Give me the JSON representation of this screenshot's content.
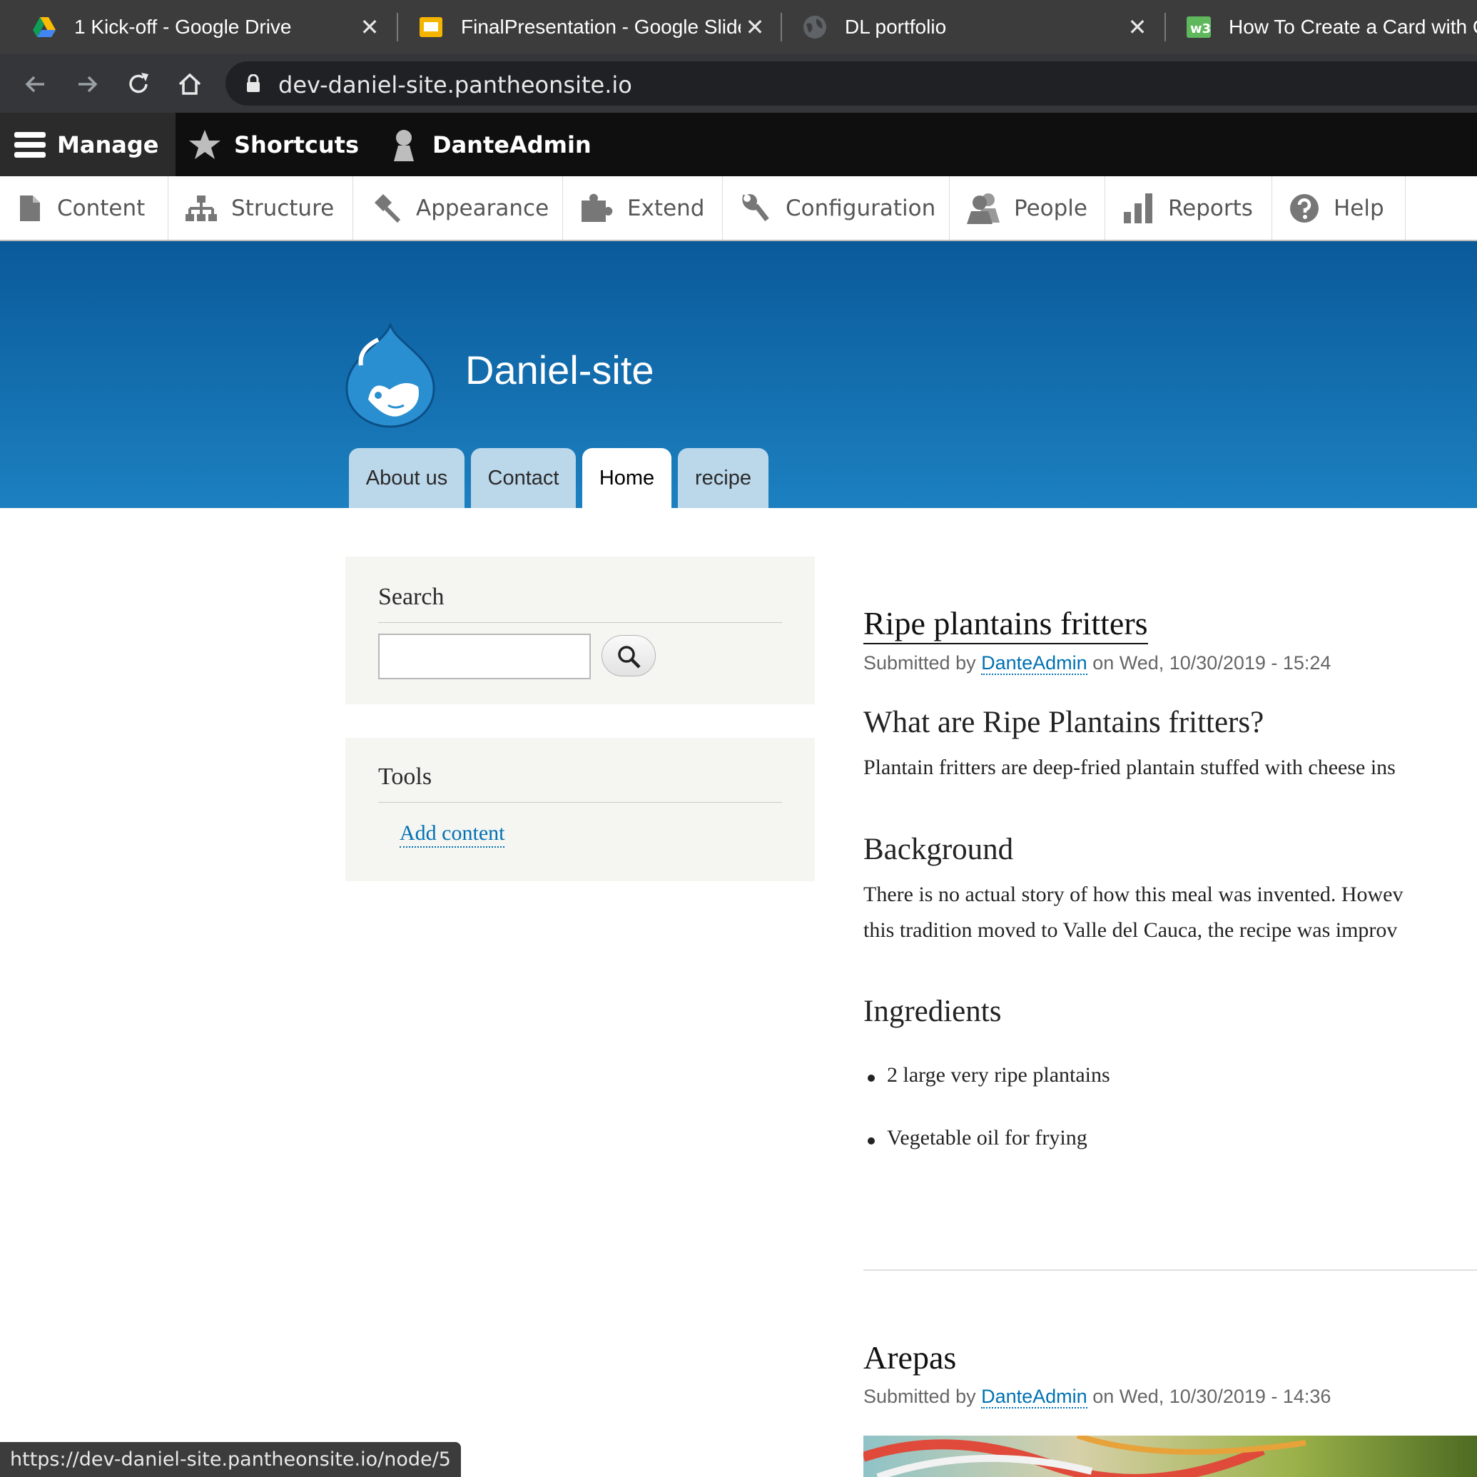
{
  "browser": {
    "tabs": [
      {
        "title": "1 Kick-off - Google Drive",
        "icon": "google-drive-icon"
      },
      {
        "title": "FinalPresentation - Google Slides",
        "icon": "google-slides-icon"
      },
      {
        "title": "DL portfolio",
        "icon": "globe-icon"
      },
      {
        "title": "How To Create a Card with CSS",
        "icon": "w3schools-icon"
      }
    ],
    "close_glyph": "✕",
    "url": "dev-daniel-site.pantheonsite.io",
    "status_url": "https://dev-daniel-site.pantheonsite.io/node/5"
  },
  "admin_toolbar": {
    "manage": "Manage",
    "shortcuts": "Shortcuts",
    "user": "DanteAdmin"
  },
  "admin_tray": {
    "items": [
      "Content",
      "Structure",
      "Appearance",
      "Extend",
      "Configuration",
      "People",
      "Reports",
      "Help"
    ]
  },
  "site": {
    "name": "Daniel-site",
    "primary_tabs": [
      "About us",
      "Contact",
      "Home",
      "recipe"
    ],
    "active_tab": "Home"
  },
  "sidebar": {
    "search_title": "Search",
    "tools_title": "Tools",
    "add_content": "Add content"
  },
  "articles": [
    {
      "title": "Ripe plantains fritters",
      "meta_prefix": "Submitted by ",
      "author": "DanteAdmin",
      "meta_suffix": " on Wed, 10/30/2019 - 15:24",
      "sections": [
        {
          "heading": "What are Ripe Plantains fritters?",
          "lines": [
            "Plantain fritters are deep-fried plantain stuffed with cheese ins"
          ]
        },
        {
          "heading": "Background",
          "lines": [
            "There is no actual story of how this meal was invented. Howev",
            "this tradition moved to Valle del Cauca,  the recipe was improv"
          ]
        },
        {
          "heading": "Ingredients",
          "items": [
            "2 large very ripe plantains",
            "Vegetable oil for frying"
          ]
        }
      ]
    },
    {
      "title": "Arepas",
      "meta_prefix": "Submitted by ",
      "author": "DanteAdmin",
      "meta_suffix": " on Wed, 10/30/2019 - 14:36"
    }
  ],
  "colors": {
    "link": "#0071b3",
    "banner_top": "#0a5a9a",
    "banner_bottom": "#1c80c0",
    "tab_inactive": "#bbd7ea"
  }
}
